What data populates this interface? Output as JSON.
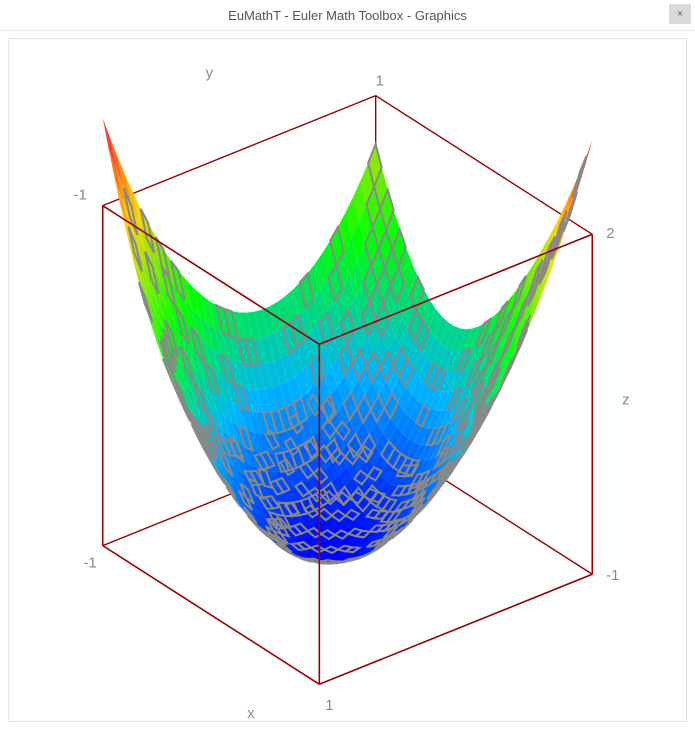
{
  "window": {
    "title": "EuMathT - Euler Math Toolbox - Graphics",
    "close_label": "×"
  },
  "chart_data": {
    "type": "surface3d",
    "description": "3D surface with contour level lines, rainbow colormap (blue low → red high), inside a red bounding cube.",
    "axes": {
      "x": {
        "label": "x",
        "ticks": [
          -1,
          1
        ]
      },
      "y": {
        "label": "y",
        "ticks": [
          -1,
          1
        ]
      },
      "z": {
        "label": "z",
        "ticks": [
          -1,
          2
        ]
      }
    },
    "domain": {
      "x": [
        -1,
        1
      ],
      "y": [
        -1,
        1
      ]
    },
    "zrange": [
      -1,
      2
    ],
    "contours": {
      "enabled": true,
      "count": 14,
      "color": "#888"
    },
    "colormap": "rainbow",
    "box_color": "#990000"
  }
}
